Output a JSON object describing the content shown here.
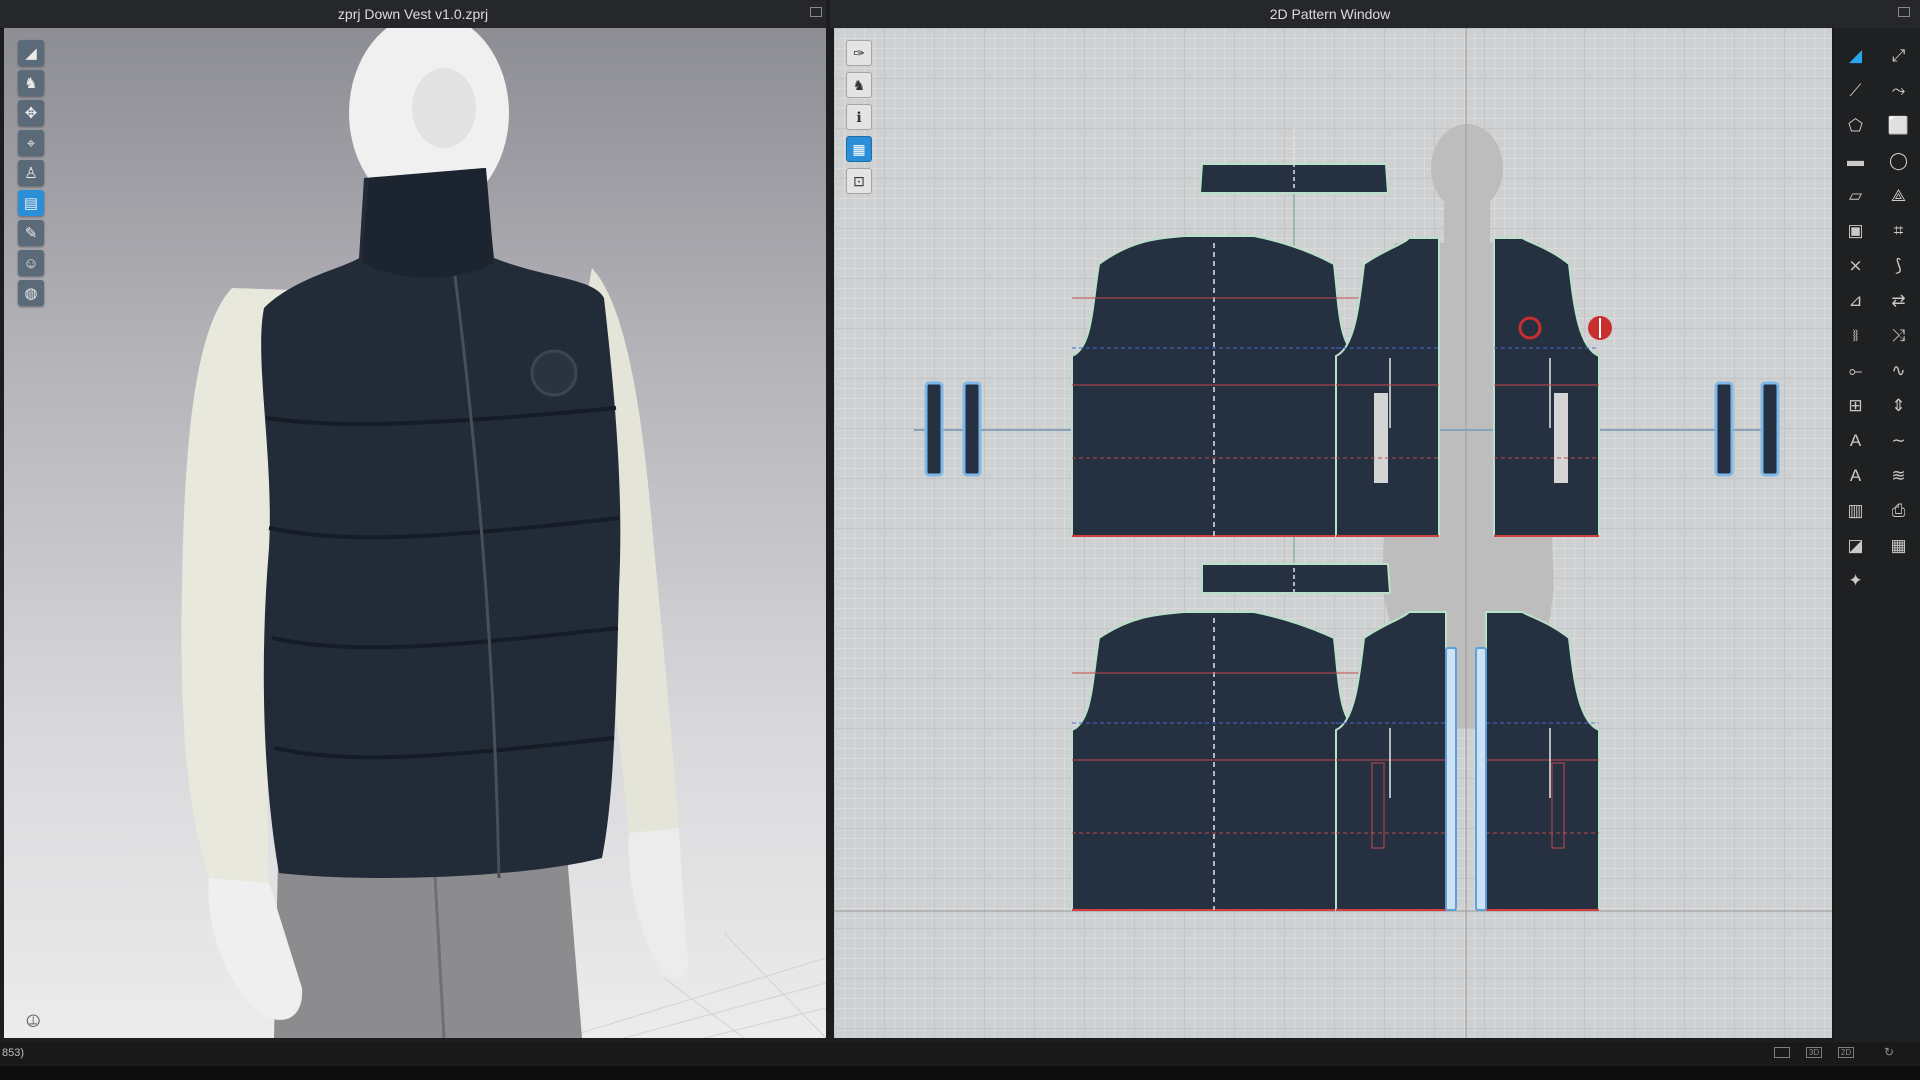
{
  "window3d": {
    "title": "zprj Down Vest v1.0.zprj",
    "tools": [
      {
        "icon": "simulation-icon",
        "glyph": "◢",
        "accent": false
      },
      {
        "icon": "garment-icon",
        "glyph": "♞",
        "accent": false
      },
      {
        "icon": "select-mesh-icon",
        "glyph": "✥",
        "accent": false
      },
      {
        "icon": "tack-icon",
        "glyph": "⌖",
        "accent": false
      },
      {
        "icon": "avatar-pin-icon",
        "glyph": "♙",
        "accent": false
      },
      {
        "icon": "fold-arrangement-icon",
        "glyph": "▤",
        "accent": true
      },
      {
        "icon": "brush-icon",
        "glyph": "✎",
        "accent": false
      },
      {
        "icon": "avatar-icon",
        "glyph": "☺",
        "accent": false
      },
      {
        "icon": "globe-icon",
        "glyph": "◍",
        "accent": false
      }
    ]
  },
  "window2d": {
    "title": "2D Pattern Window",
    "tools": [
      {
        "icon": "transform-pattern-icon",
        "glyph": "✑",
        "accent": false
      },
      {
        "icon": "shirt-icon",
        "glyph": "♞",
        "accent": false
      },
      {
        "icon": "info-icon",
        "glyph": "ℹ",
        "accent": false
      },
      {
        "icon": "texture-icon",
        "glyph": "▦",
        "accent": true
      },
      {
        "icon": "lock-icon",
        "glyph": "⊡",
        "accent": false
      }
    ]
  },
  "right_toolbar": [
    {
      "icon": "edit-pattern-icon",
      "glyph": "◢",
      "accent": true
    },
    {
      "icon": "transform-icon",
      "glyph": "⤢",
      "accent": false
    },
    {
      "icon": "edit-point-icon",
      "glyph": "⟋",
      "accent": false
    },
    {
      "icon": "curve-point-icon",
      "glyph": "⤳",
      "accent": false
    },
    {
      "icon": "polygon-icon",
      "glyph": "⬠",
      "accent": false
    },
    {
      "icon": "rectangle-pattern-icon",
      "glyph": "⬜",
      "accent": false
    },
    {
      "icon": "rectangle-icon",
      "glyph": "▬",
      "accent": false
    },
    {
      "icon": "circle-icon",
      "glyph": "◯",
      "accent": false
    },
    {
      "icon": "internal-polygon-icon",
      "glyph": "▱",
      "accent": false
    },
    {
      "icon": "dart-icon",
      "glyph": "⟁",
      "accent": false
    },
    {
      "icon": "hole-icon",
      "glyph": "▣",
      "accent": false
    },
    {
      "icon": "trace-icon",
      "glyph": "⌗",
      "accent": false
    },
    {
      "icon": "segment-sewing-icon",
      "glyph": "⨯",
      "accent": false
    },
    {
      "icon": "free-sewing-icon",
      "glyph": "⟆",
      "accent": false
    },
    {
      "icon": "fold-icon",
      "glyph": "⊿",
      "accent": false
    },
    {
      "icon": "flip-icon",
      "glyph": "⇄",
      "accent": false
    },
    {
      "icon": "zipper-icon",
      "glyph": "⧚",
      "accent": false
    },
    {
      "icon": "puckering-icon",
      "glyph": "⤨",
      "accent": false
    },
    {
      "icon": "elastic-icon",
      "glyph": "⟜",
      "accent": false
    },
    {
      "icon": "piping-icon",
      "glyph": "∿",
      "accent": false
    },
    {
      "icon": "ruler-icon",
      "glyph": "⊞",
      "accent": false
    },
    {
      "icon": "measure-icon",
      "glyph": "⇕",
      "accent": false
    },
    {
      "icon": "text-icon",
      "glyph": "A",
      "accent": false
    },
    {
      "icon": "annotation-icon",
      "glyph": "∼",
      "accent": false
    },
    {
      "icon": "text-small-icon",
      "glyph": "A",
      "accent": false
    },
    {
      "icon": "topstitch-icon",
      "glyph": "≋",
      "accent": false
    },
    {
      "icon": "grid-pattern-icon",
      "glyph": "▥",
      "accent": false
    },
    {
      "icon": "print-icon",
      "glyph": "⎙",
      "accent": false
    },
    {
      "icon": "fabric-icon",
      "glyph": "◪",
      "accent": false
    },
    {
      "icon": "layout-icon",
      "glyph": "▦",
      "accent": false
    },
    {
      "icon": "pin-tool-icon",
      "glyph": "✦",
      "accent": false
    }
  ],
  "statusbar": {
    "left_text": "853)",
    "view_modes": [
      "",
      "3D",
      "2D"
    ]
  }
}
